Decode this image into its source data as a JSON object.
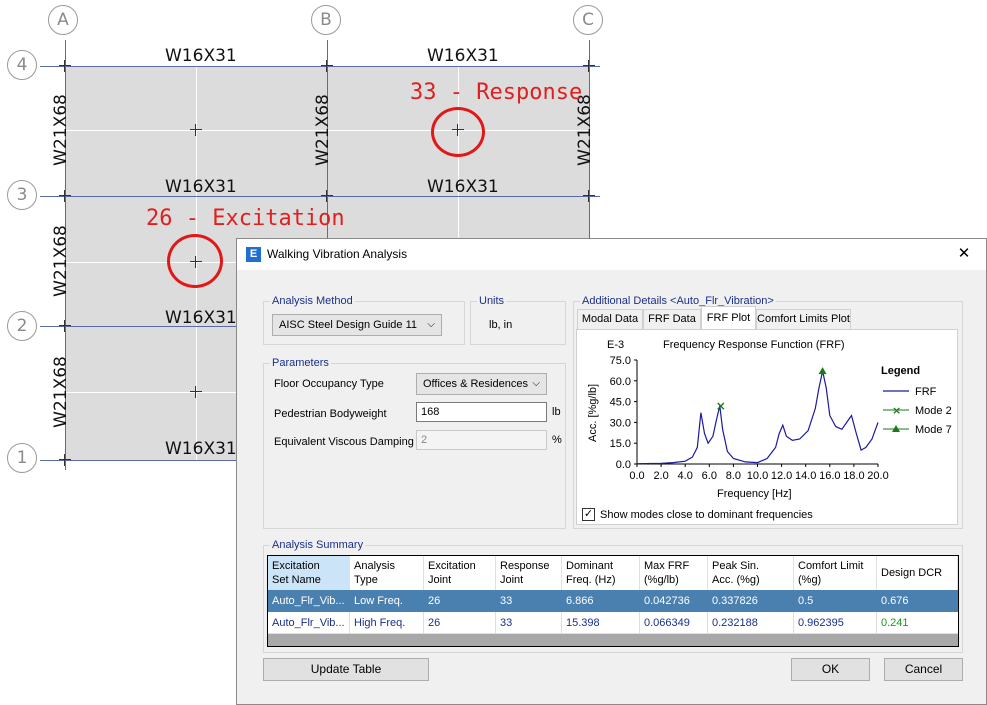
{
  "plan": {
    "col_bubbles": [
      "A",
      "B",
      "C"
    ],
    "row_bubbles": [
      "4",
      "3",
      "2",
      "1"
    ],
    "horizontal_beam_labels": [
      "W16X31",
      "W16X31",
      "W16X31",
      "W16X31",
      "W16X31"
    ],
    "vertical_beam_labels": [
      "W21X68",
      "W21X68",
      "W21X68",
      "W21X68",
      "W21X68",
      "W21X68"
    ],
    "annotations": {
      "response": "33 - Response",
      "excitation": "26 - Excitation"
    }
  },
  "dialog": {
    "title": "Walking Vibration Analysis",
    "analysis_method": {
      "group_title": "Analysis Method",
      "selected": "AISC Steel Design Guide 11"
    },
    "units": {
      "group_title": "Units",
      "value": "lb, in"
    },
    "parameters": {
      "group_title": "Parameters",
      "floor_occupancy_label": "Floor Occupancy Type",
      "floor_occupancy_value": "Offices & Residences",
      "bodyweight_label": "Pedestrian Bodyweight",
      "bodyweight_value": "168",
      "bodyweight_unit": "lb",
      "damping_label": "Equivalent Viscous Damping",
      "damping_value": "2",
      "damping_unit": "%"
    },
    "details": {
      "group_title": "Additional Details <Auto_Flr_Vibration>",
      "tabs": [
        "Modal Data",
        "FRF Data",
        "FRF Plot",
        "Comfort Limits Plot"
      ],
      "active_tab": "FRF Plot",
      "show_modes_label": "Show modes close to dominant frequencies",
      "show_modes_checked": true
    },
    "summary": {
      "group_title": "Analysis Summary",
      "columns": [
        "Excitation\nSet Name",
        "Analysis\nType",
        "Excitation\nJoint",
        "Response\nJoint",
        "Dominant\nFreq. (Hz)",
        "Max FRF\n(%g/lb)",
        "Peak Sin.\nAcc. (%g)",
        "Comfort Limit\n(%g)",
        "Design DCR"
      ],
      "rows": [
        [
          "Auto_Flr_Vib...",
          "Low Freq.",
          "26",
          "33",
          "6.866",
          "0.042736",
          "0.337826",
          "0.5",
          "0.676"
        ],
        [
          "Auto_Flr_Vib...",
          "High Freq.",
          "26",
          "33",
          "15.398",
          "0.066349",
          "0.232188",
          "0.962395",
          "0.241"
        ]
      ]
    },
    "buttons": {
      "update_table": "Update Table",
      "ok": "OK",
      "cancel": "Cancel"
    },
    "app_icon_letter": "E",
    "close_symbol": "✕"
  },
  "chart_data": {
    "type": "line",
    "title": "Frequency Response Function (FRF)",
    "multiplier": "E-3",
    "xlabel": "Frequency [Hz]",
    "ylabel": "Acc. [%g/lb]",
    "xlim": [
      0,
      20
    ],
    "ylim": [
      0,
      75
    ],
    "x_ticks": [
      "0.0",
      "2.0",
      "4.0",
      "6.0",
      "8.0",
      "10.0",
      "12.0",
      "14.0",
      "16.0",
      "18.0",
      "20.0"
    ],
    "y_ticks": [
      "0.0",
      "15.0",
      "30.0",
      "45.0",
      "60.0",
      "75.0"
    ],
    "legend_title": "Legend",
    "legend_position": "right",
    "series": [
      {
        "name": "FRF",
        "color": "#1a1aa0",
        "x": [
          0,
          2,
          3,
          4,
          4.6,
          5.0,
          5.3,
          5.6,
          5.9,
          6.3,
          6.6,
          6.87,
          7.1,
          7.5,
          8,
          9,
          10,
          10.8,
          11.5,
          11.8,
          12.1,
          12.4,
          12.9,
          13.5,
          14.2,
          14.8,
          15.1,
          15.4,
          15.7,
          16.0,
          16.5,
          17.0,
          17.4,
          17.8,
          18.2,
          18.6,
          19.0,
          19.5,
          20
        ],
        "y": [
          0.2,
          0.4,
          1.0,
          2.0,
          5.0,
          12.0,
          37.0,
          22.0,
          15.0,
          20.0,
          32.0,
          42.0,
          25.0,
          9.0,
          4.0,
          1.5,
          1.0,
          4.0,
          12.0,
          22.0,
          28.0,
          20.0,
          17.0,
          18.0,
          24.0,
          40.0,
          55.0,
          67.0,
          55.0,
          35.0,
          27.0,
          25.0,
          30.0,
          35.0,
          22.0,
          10.0,
          12.0,
          18.0,
          30.0
        ]
      }
    ],
    "markers": [
      {
        "name": "Mode 2",
        "symbol": "x",
        "color": "#1a7a1a",
        "x": 6.87,
        "y": 42.0
      },
      {
        "name": "Mode 7",
        "symbol": "triangle",
        "color": "#1a7a1a",
        "x": 15.4,
        "y": 67.0
      }
    ]
  }
}
